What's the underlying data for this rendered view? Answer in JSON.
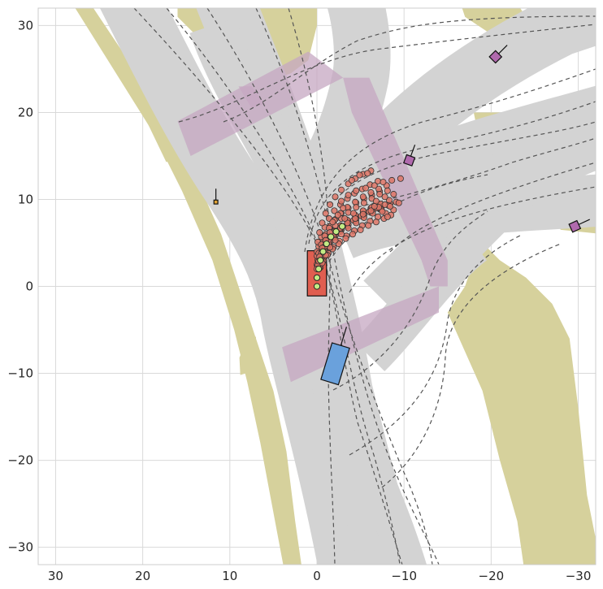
{
  "chart_data": {
    "type": "scatter",
    "title": "",
    "xlabel": "",
    "ylabel": "",
    "xlim": [
      32,
      -32
    ],
    "ylim": [
      -32,
      32
    ],
    "x_ticks": [
      30,
      20,
      10,
      0,
      -10,
      -20,
      -30
    ],
    "y_ticks": [
      30,
      20,
      10,
      0,
      -10,
      -20,
      -30
    ],
    "x_tick_labels": [
      "30",
      "20",
      "10",
      "0",
      "−10",
      "−20",
      "−30"
    ],
    "y_tick_labels": [
      "30",
      "20",
      "10",
      "0",
      "−10",
      "−20",
      "−30"
    ],
    "grid": true,
    "colors": {
      "road": "#d3d3d3",
      "offroad": "#d6d19c",
      "crosswalk": "#c6a7c2",
      "lane_line": "#555555",
      "ego": "#e05e50",
      "other_vehicle": "#6aa1dc",
      "agent": "#b06aad",
      "pedestrian": "#e0a233",
      "predicted_point": "#de7566",
      "planned_point": "#c3eb85",
      "grid": "#d9d9d9"
    },
    "series": [
      {
        "kind": "planned_trajectory",
        "points": [
          [
            0,
            0
          ],
          [
            0.0,
            1.0
          ],
          [
            -0.2,
            2.0
          ],
          [
            -0.4,
            3.0
          ],
          [
            -0.7,
            4.0
          ],
          [
            -1.1,
            4.9
          ],
          [
            -1.6,
            5.7
          ],
          [
            -2.2,
            6.3
          ],
          [
            -2.9,
            6.9
          ]
        ]
      },
      {
        "kind": "sampled_trajectories",
        "points": [
          [
            0.0,
            2.5
          ],
          [
            -0.2,
            3.4
          ],
          [
            -0.5,
            4.3
          ],
          [
            -0.9,
            5.1
          ],
          [
            -1.4,
            5.8
          ],
          [
            -2.0,
            6.4
          ],
          [
            -2.7,
            7.0
          ],
          [
            -3.5,
            7.6
          ],
          [
            -4.4,
            8.1
          ],
          [
            -5.3,
            8.6
          ],
          [
            -6.2,
            9.0
          ],
          [
            -7.1,
            9.4
          ],
          [
            -0.3,
            2.6
          ],
          [
            -0.6,
            3.5
          ],
          [
            -1.0,
            4.3
          ],
          [
            -1.5,
            5.1
          ],
          [
            -2.1,
            5.8
          ],
          [
            -2.8,
            6.5
          ],
          [
            -3.6,
            7.1
          ],
          [
            -4.5,
            7.7
          ],
          [
            -5.4,
            8.2
          ],
          [
            -6.4,
            8.7
          ],
          [
            -7.4,
            9.1
          ],
          [
            -8.4,
            9.5
          ],
          [
            -0.1,
            3.0
          ],
          [
            -0.3,
            4.0
          ],
          [
            -0.6,
            5.0
          ],
          [
            -1.0,
            6.0
          ],
          [
            -1.5,
            6.9
          ],
          [
            -2.1,
            7.7
          ],
          [
            -2.8,
            8.4
          ],
          [
            -3.6,
            9.0
          ],
          [
            -4.5,
            9.6
          ],
          [
            -5.4,
            10.1
          ],
          [
            -6.3,
            10.5
          ],
          [
            -7.2,
            10.9
          ],
          [
            -0.4,
            2.2
          ],
          [
            -0.8,
            3.0
          ],
          [
            -1.3,
            3.8
          ],
          [
            -1.9,
            4.5
          ],
          [
            -2.6,
            5.2
          ],
          [
            -3.4,
            5.8
          ],
          [
            -4.3,
            6.4
          ],
          [
            -5.2,
            7.0
          ],
          [
            -6.1,
            7.5
          ],
          [
            -7.0,
            8.0
          ],
          [
            -7.9,
            8.4
          ],
          [
            -8.8,
            8.8
          ],
          [
            0.0,
            3.5
          ],
          [
            -0.2,
            4.6
          ],
          [
            -0.5,
            5.7
          ],
          [
            -0.9,
            6.8
          ],
          [
            -1.4,
            7.8
          ],
          [
            -2.0,
            8.7
          ],
          [
            -2.7,
            9.4
          ],
          [
            -3.5,
            10.1
          ],
          [
            -4.3,
            10.7
          ],
          [
            -5.2,
            11.2
          ],
          [
            -6.1,
            11.7
          ],
          [
            -7.0,
            12.1
          ],
          [
            -0.2,
            2.8
          ],
          [
            -0.5,
            3.8
          ],
          [
            -0.9,
            4.7
          ],
          [
            -1.4,
            5.5
          ],
          [
            -2.0,
            6.3
          ],
          [
            -2.7,
            7.0
          ],
          [
            -3.5,
            7.6
          ],
          [
            -4.4,
            8.2
          ],
          [
            -5.3,
            8.7
          ],
          [
            -6.3,
            9.1
          ],
          [
            -7.3,
            9.5
          ],
          [
            -8.3,
            9.9
          ],
          [
            -0.3,
            2.1
          ],
          [
            -0.7,
            2.9
          ],
          [
            -1.2,
            3.6
          ],
          [
            -1.8,
            4.3
          ],
          [
            -2.5,
            4.9
          ],
          [
            -3.3,
            5.5
          ],
          [
            -4.1,
            6.0
          ],
          [
            -5.0,
            6.5
          ],
          [
            -5.9,
            7.0
          ],
          [
            -6.8,
            7.4
          ],
          [
            -7.7,
            7.8
          ],
          [
            -8.5,
            8.2
          ],
          [
            0.0,
            4.0
          ],
          [
            -0.1,
            5.1
          ],
          [
            -0.3,
            6.2
          ],
          [
            -0.6,
            7.3
          ],
          [
            -1.0,
            8.4
          ],
          [
            -1.5,
            9.4
          ],
          [
            -2.1,
            10.3
          ],
          [
            -2.8,
            11.1
          ],
          [
            -3.6,
            11.8
          ],
          [
            -4.4,
            12.4
          ],
          [
            -5.3,
            12.9
          ],
          [
            -6.2,
            13.3
          ],
          [
            -0.5,
            3.2
          ],
          [
            -0.9,
            4.1
          ],
          [
            -1.4,
            4.9
          ],
          [
            -2.0,
            5.6
          ],
          [
            -2.7,
            6.3
          ],
          [
            -3.5,
            6.9
          ],
          [
            -4.4,
            7.5
          ],
          [
            -5.3,
            8.0
          ],
          [
            -6.2,
            8.5
          ],
          [
            -7.2,
            8.9
          ],
          [
            -8.2,
            9.3
          ],
          [
            -9.1,
            9.7
          ],
          [
            -0.1,
            2.4
          ],
          [
            -0.4,
            3.3
          ],
          [
            -0.8,
            4.2
          ],
          [
            -1.3,
            5.0
          ],
          [
            -1.9,
            5.7
          ],
          [
            -2.6,
            6.4
          ],
          [
            -3.4,
            7.0
          ],
          [
            -4.2,
            7.6
          ],
          [
            -5.1,
            8.1
          ],
          [
            -6.0,
            8.6
          ],
          [
            -6.9,
            9.0
          ],
          [
            -7.8,
            9.4
          ],
          [
            -0.2,
            3.8
          ],
          [
            -0.5,
            4.8
          ],
          [
            -0.9,
            5.8
          ],
          [
            -1.4,
            6.7
          ],
          [
            -2.0,
            7.6
          ],
          [
            -2.7,
            8.4
          ],
          [
            -3.5,
            9.1
          ],
          [
            -4.4,
            9.7
          ],
          [
            -5.3,
            10.3
          ],
          [
            -6.2,
            10.8
          ],
          [
            -7.1,
            11.2
          ],
          [
            -8.0,
            11.6
          ],
          [
            -0.6,
            2.7
          ],
          [
            -1.0,
            3.6
          ],
          [
            -1.5,
            4.5
          ],
          [
            -2.1,
            5.3
          ],
          [
            -2.8,
            6.0
          ],
          [
            -3.6,
            6.7
          ],
          [
            -4.5,
            7.3
          ],
          [
            -5.4,
            7.9
          ],
          [
            -6.4,
            8.4
          ],
          [
            -7.4,
            8.8
          ],
          [
            -8.4,
            9.2
          ],
          [
            -9.4,
            9.6
          ],
          [
            0.0,
            2.0
          ],
          [
            -0.2,
            2.9
          ],
          [
            -0.5,
            3.8
          ],
          [
            -0.9,
            4.6
          ],
          [
            -1.4,
            5.4
          ],
          [
            -2.0,
            6.1
          ],
          [
            -2.7,
            6.7
          ],
          [
            -3.5,
            7.3
          ],
          [
            -4.4,
            7.8
          ],
          [
            -5.3,
            8.3
          ],
          [
            -6.2,
            8.7
          ],
          [
            -7.1,
            9.1
          ],
          [
            -0.3,
            3.4
          ],
          [
            -0.6,
            4.4
          ],
          [
            -1.0,
            5.3
          ],
          [
            -1.5,
            6.2
          ],
          [
            -2.1,
            7.0
          ],
          [
            -2.8,
            7.8
          ],
          [
            -3.6,
            8.5
          ],
          [
            -4.5,
            9.1
          ],
          [
            -5.4,
            9.6
          ],
          [
            -6.3,
            10.1
          ],
          [
            -7.2,
            10.6
          ],
          [
            -8.1,
            11.0
          ],
          [
            -2.8,
            9.8
          ],
          [
            -3.6,
            10.5
          ],
          [
            -4.5,
            11.0
          ],
          [
            -5.6,
            11.3
          ],
          [
            -6.6,
            11.6
          ],
          [
            -7.6,
            12.0
          ],
          [
            -8.6,
            12.2
          ],
          [
            -9.6,
            12.4
          ],
          [
            -4.0,
            12.2
          ],
          [
            -4.9,
            12.8
          ],
          [
            -5.8,
            13.0
          ],
          [
            -3.2,
            7.8
          ],
          [
            -4.2,
            8.4
          ],
          [
            -6.8,
            9.8
          ],
          [
            -7.8,
            10.3
          ],
          [
            -8.8,
            10.6
          ],
          [
            -1.8,
            7.4
          ],
          [
            -2.4,
            8.2
          ],
          [
            -3.0,
            9.0
          ],
          [
            -6.6,
            9.2
          ],
          [
            -7.5,
            8.6
          ],
          [
            -8.1,
            8.0
          ]
        ]
      }
    ],
    "objects": [
      {
        "name": "ego",
        "center": [
          0.0,
          1.5
        ],
        "size": [
          2.2,
          5.2
        ],
        "heading_deg": 0
      },
      {
        "name": "other_vehicle",
        "center": [
          -2.1,
          -8.9
        ],
        "size": [
          2.1,
          4.4
        ],
        "heading_deg": 17
      },
      {
        "name": "agent",
        "center": [
          -10.6,
          14.5
        ],
        "size": [
          1.0,
          1.0
        ],
        "heading_deg": 20
      },
      {
        "name": "agent",
        "center": [
          -20.5,
          26.4
        ],
        "size": [
          1.0,
          1.0
        ],
        "heading_deg": 45
      },
      {
        "name": "agent",
        "center": [
          -29.6,
          6.9
        ],
        "size": [
          1.0,
          1.0
        ],
        "heading_deg": 65
      },
      {
        "name": "pedestrian",
        "center": [
          11.6,
          9.7
        ],
        "size": [
          0.45,
          0.45
        ],
        "heading_deg": 0
      }
    ]
  }
}
